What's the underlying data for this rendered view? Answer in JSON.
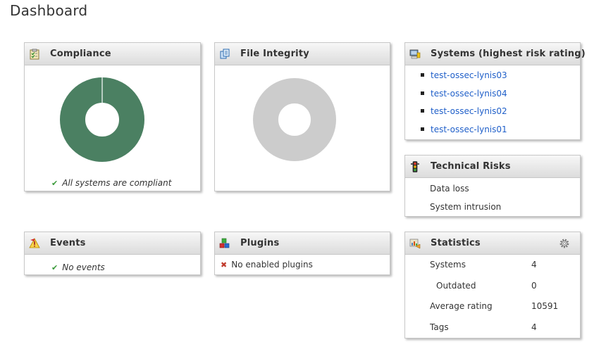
{
  "page": {
    "title": "Dashboard"
  },
  "compliance": {
    "title": "Compliance",
    "chart_color": "#4b8062",
    "message": "All systems are compliant"
  },
  "file_integrity": {
    "title": "File Integrity",
    "chart_color": "#cccccc"
  },
  "systems": {
    "title": "Systems (highest risk rating)",
    "items": [
      {
        "label": "test-ossec-lynis03"
      },
      {
        "label": "test-ossec-lynis04"
      },
      {
        "label": "test-ossec-lynis02"
      },
      {
        "label": "test-ossec-lynis01"
      }
    ]
  },
  "technical_risks": {
    "title": "Technical Risks",
    "items": [
      "Data loss",
      "System intrusion"
    ]
  },
  "events": {
    "title": "Events",
    "message": "No events"
  },
  "plugins": {
    "title": "Plugins",
    "message": "No enabled plugins"
  },
  "statistics": {
    "title": "Statistics",
    "rows": [
      {
        "label": "Systems",
        "value": "4"
      },
      {
        "label": "Outdated",
        "value": "0"
      },
      {
        "label": "Average rating",
        "value": "10591"
      },
      {
        "label": "Tags",
        "value": "4"
      }
    ]
  },
  "colors": {
    "link": "#1f5fc9",
    "check": "#3a9a3a",
    "cross": "#c0392b"
  }
}
